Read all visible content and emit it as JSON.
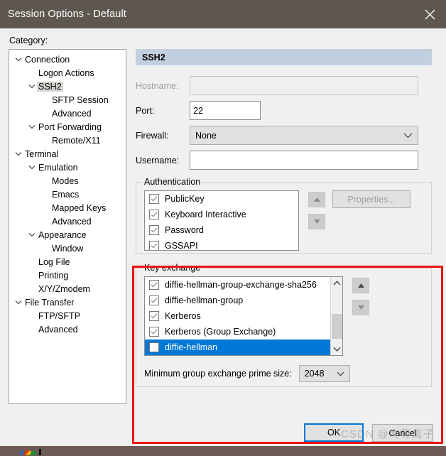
{
  "window": {
    "title": "Session Options - Default",
    "close_icon": "close-icon"
  },
  "category": {
    "label": "Category:",
    "items": [
      {
        "label": "Connection",
        "indent": 0,
        "expandable": true,
        "selected": false
      },
      {
        "label": "Logon Actions",
        "indent": 1,
        "expandable": false,
        "selected": false
      },
      {
        "label": "SSH2",
        "indent": 1,
        "expandable": true,
        "selected": true
      },
      {
        "label": "SFTP Session",
        "indent": 2,
        "expandable": false,
        "selected": false
      },
      {
        "label": "Advanced",
        "indent": 2,
        "expandable": false,
        "selected": false
      },
      {
        "label": "Port Forwarding",
        "indent": 1,
        "expandable": true,
        "selected": false
      },
      {
        "label": "Remote/X11",
        "indent": 2,
        "expandable": false,
        "selected": false
      },
      {
        "label": "Terminal",
        "indent": 0,
        "expandable": true,
        "selected": false
      },
      {
        "label": "Emulation",
        "indent": 1,
        "expandable": true,
        "selected": false
      },
      {
        "label": "Modes",
        "indent": 2,
        "expandable": false,
        "selected": false
      },
      {
        "label": "Emacs",
        "indent": 2,
        "expandable": false,
        "selected": false
      },
      {
        "label": "Mapped Keys",
        "indent": 2,
        "expandable": false,
        "selected": false
      },
      {
        "label": "Advanced",
        "indent": 2,
        "expandable": false,
        "selected": false
      },
      {
        "label": "Appearance",
        "indent": 1,
        "expandable": true,
        "selected": false
      },
      {
        "label": "Window",
        "indent": 2,
        "expandable": false,
        "selected": false
      },
      {
        "label": "Log File",
        "indent": 1,
        "expandable": false,
        "selected": false
      },
      {
        "label": "Printing",
        "indent": 1,
        "expandable": false,
        "selected": false
      },
      {
        "label": "X/Y/Zmodem",
        "indent": 1,
        "expandable": false,
        "selected": false
      },
      {
        "label": "File Transfer",
        "indent": 0,
        "expandable": true,
        "selected": false
      },
      {
        "label": "FTP/SFTP",
        "indent": 1,
        "expandable": false,
        "selected": false
      },
      {
        "label": "Advanced",
        "indent": 1,
        "expandable": false,
        "selected": false
      }
    ]
  },
  "pane": {
    "banner_title": "SSH2",
    "hostname": {
      "label": "Hostname:",
      "value": "",
      "disabled": true
    },
    "port": {
      "label": "Port:",
      "value": "22"
    },
    "firewall": {
      "label": "Firewall:",
      "value": "None"
    },
    "username": {
      "label": "Username:",
      "value": ""
    }
  },
  "authentication": {
    "title": "Authentication",
    "items": [
      {
        "label": "PublicKey",
        "checked": true,
        "selected": false
      },
      {
        "label": "Keyboard Interactive",
        "checked": true,
        "selected": false
      },
      {
        "label": "Password",
        "checked": true,
        "selected": false
      },
      {
        "label": "GSSAPI",
        "checked": true,
        "selected": false
      }
    ],
    "move_up_icon": "arrow-up-icon",
    "move_down_icon": "arrow-down-icon",
    "properties_button": "Properties..."
  },
  "key_exchange": {
    "title": "Key exchange",
    "items": [
      {
        "label": "diffie-hellman-group-exchange-sha256",
        "checked": true,
        "selected": false
      },
      {
        "label": "diffie-hellman-group",
        "checked": true,
        "selected": false
      },
      {
        "label": "Kerberos",
        "checked": true,
        "selected": false
      },
      {
        "label": "Kerberos (Group Exchange)",
        "checked": true,
        "selected": false
      },
      {
        "label": "diffie-hellman",
        "checked": true,
        "selected": true
      }
    ],
    "move_up_icon": "arrow-up-icon",
    "move_down_icon": "arrow-down-icon",
    "prime_size": {
      "label": "Minimum group exchange prime size:",
      "value": "2048"
    },
    "scroll_up_icon": "chevron-up-icon",
    "scroll_down_icon": "chevron-down-icon"
  },
  "footer": {
    "ok_label": "OK",
    "cancel_label": "Cancel"
  },
  "annotation": {
    "highlight_color": "#ee1111",
    "watermark": "CSDN @吻等离子"
  },
  "colors": {
    "titlebar": "#5e5750",
    "dialog_bg": "#f0f0f0",
    "banner": "#c2cfdf",
    "selection": "#0078d7",
    "tree_selection": "#d6d3ce"
  }
}
